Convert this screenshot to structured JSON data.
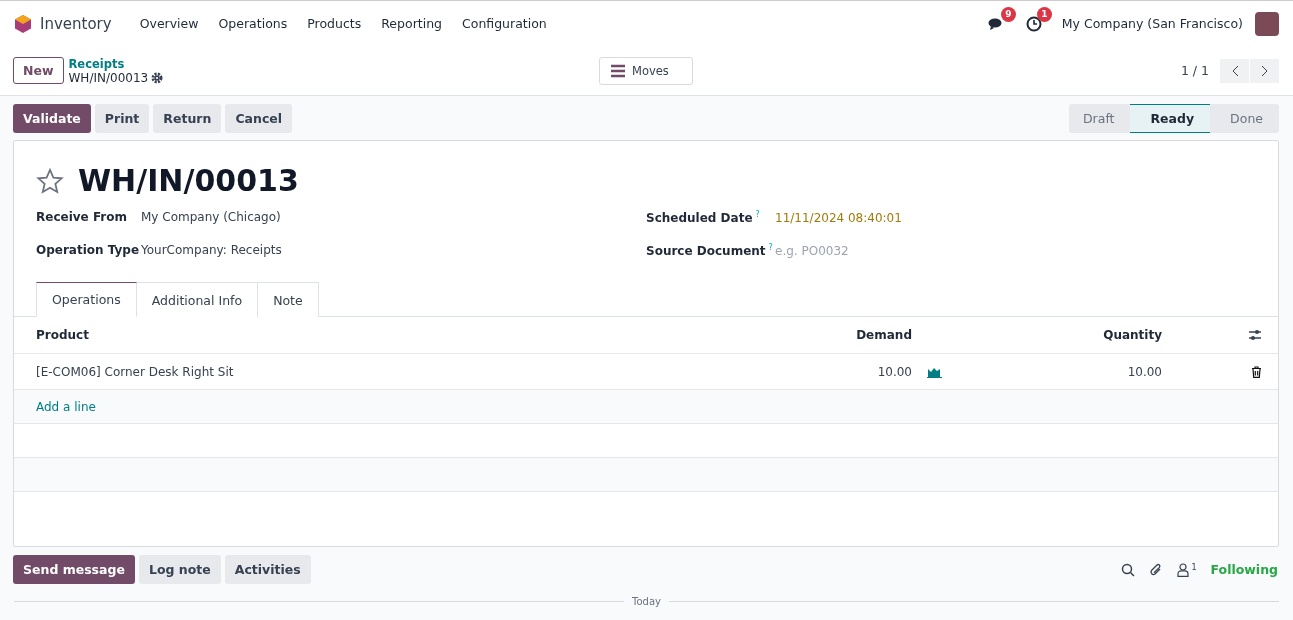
{
  "navbar": {
    "app_name": "Inventory",
    "menu": [
      "Overview",
      "Operations",
      "Products",
      "Reporting",
      "Configuration"
    ],
    "messages_badge": "9",
    "activities_badge": "1",
    "company": "My Company (San Francisco)"
  },
  "control_panel": {
    "new_button": "New",
    "breadcrumb": "Receipts",
    "record": "WH/IN/00013",
    "moves_button": "Moves",
    "pager": "1 / 1"
  },
  "actions": [
    "Validate",
    "Print",
    "Return",
    "Cancel"
  ],
  "stages": [
    {
      "label": "Draft",
      "selected": false
    },
    {
      "label": "Ready",
      "selected": true
    },
    {
      "label": "Done",
      "selected": false
    }
  ],
  "form": {
    "title": "WH/IN/00013",
    "starred": false,
    "left_fields": [
      {
        "label": "Receive From",
        "value": "My Company (Chicago)"
      },
      {
        "label": "Operation Type",
        "value": "YourCompany: Receipts"
      }
    ],
    "right_fields": [
      {
        "label": "Scheduled Date",
        "help": "?",
        "value": "11/11/2024 08:40:01",
        "kind": "date"
      },
      {
        "label": "Source Document",
        "help": "?",
        "placeholder": "e.g. PO0032",
        "kind": "input"
      }
    ],
    "tabs": [
      {
        "label": "Operations",
        "selected": true
      },
      {
        "label": "Additional Info",
        "selected": false
      },
      {
        "label": "Note",
        "selected": false
      }
    ],
    "table": {
      "columns": [
        "Product",
        "Demand",
        "Quantity"
      ],
      "rows": [
        {
          "product": "[E-COM06] Corner Desk Right Sit",
          "demand": "10.00",
          "quantity": "10.00"
        }
      ],
      "add_line": "Add a line"
    }
  },
  "chatter": {
    "buttons": [
      "Send message",
      "Log note",
      "Activities"
    ],
    "followers_count": "1",
    "following": "Following",
    "divider": "Today"
  }
}
